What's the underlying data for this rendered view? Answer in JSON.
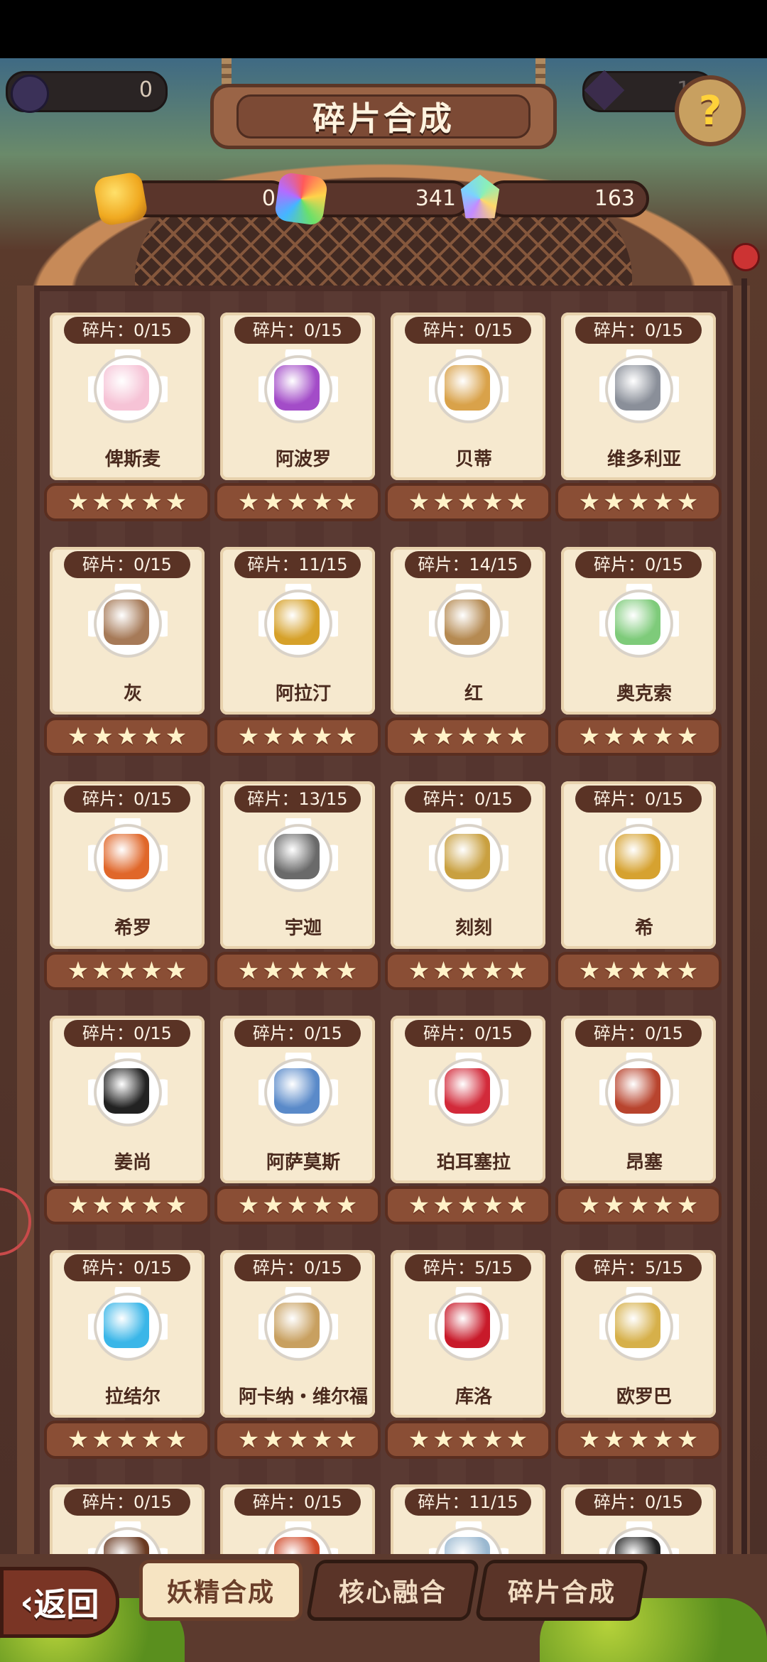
{
  "top": {
    "left_currency_value": "0",
    "right_currency_value": "1"
  },
  "header": {
    "title": "碎片合成",
    "help_label": "?"
  },
  "currencies": [
    {
      "icon": "gold-puzzle-piece-icon",
      "value": "0"
    },
    {
      "icon": "rainbow-puzzle-piece-icon",
      "value": "341"
    },
    {
      "icon": "crystal-icon",
      "value": "163"
    }
  ],
  "cards": [
    {
      "fragments": "碎片：0/15",
      "name": "俾斯麦",
      "item": "marshmallow",
      "color": "#f6c3d6"
    },
    {
      "fragments": "碎片：0/15",
      "name": "阿波罗",
      "item": "purple-orb",
      "color": "#a34cc8"
    },
    {
      "fragments": "碎片：0/15",
      "name": "贝蒂",
      "item": "scissors",
      "color": "#d9a24a"
    },
    {
      "fragments": "碎片：0/15",
      "name": "维多利亚",
      "item": "dish",
      "color": "#8a8f99"
    },
    {
      "fragments": "碎片：0/15",
      "name": "灰",
      "item": "brush",
      "color": "#a67a58"
    },
    {
      "fragments": "碎片：11/15",
      "name": "阿拉汀",
      "item": "lamp",
      "color": "#d6a12a"
    },
    {
      "fragments": "碎片：14/15",
      "name": "红",
      "item": "basket",
      "color": "#b58a52"
    },
    {
      "fragments": "碎片：0/15",
      "name": "奥克索",
      "item": "pinwheel",
      "color": "#7ecb7a"
    },
    {
      "fragments": "碎片：0/15",
      "name": "希罗",
      "item": "lantern",
      "color": "#e0672a"
    },
    {
      "fragments": "碎片：13/15",
      "name": "宇迦",
      "item": "drum",
      "color": "#6a6a6a"
    },
    {
      "fragments": "碎片：0/15",
      "name": "刻刻",
      "item": "pocket-watch",
      "color": "#c9a040"
    },
    {
      "fragments": "碎片：0/15",
      "name": "希",
      "item": "key",
      "color": "#d6a230"
    },
    {
      "fragments": "碎片：0/15",
      "name": "姜尚",
      "item": "yin-yang",
      "color": "#222222"
    },
    {
      "fragments": "碎片：0/15",
      "name": "阿萨莫斯",
      "item": "eye-orb",
      "color": "#5a8ac9"
    },
    {
      "fragments": "碎片：0/15",
      "name": "珀耳塞拉",
      "item": "dice",
      "color": "#d22a3a"
    },
    {
      "fragments": "碎片：0/15",
      "name": "昂塞",
      "item": "book",
      "color": "#b8442e"
    },
    {
      "fragments": "碎片：0/15",
      "name": "拉结尔",
      "item": "mirror",
      "color": "#3ab6e8"
    },
    {
      "fragments": "碎片：0/15",
      "name": "阿卡纳・维尔福",
      "item": "card",
      "color": "#c8a060"
    },
    {
      "fragments": "碎片：5/15",
      "name": "库洛",
      "item": "apple",
      "color": "#c81a2a"
    },
    {
      "fragments": "碎片：5/15",
      "name": "欧罗巴",
      "item": "harp",
      "color": "#d6b04a"
    },
    {
      "fragments": "碎片：0/15",
      "name": "",
      "item": "violin",
      "color": "#6a3a22"
    },
    {
      "fragments": "碎片：0/15",
      "name": "",
      "item": "crown",
      "color": "#d04a2a"
    },
    {
      "fragments": "碎片：11/15",
      "name": "",
      "item": "bracelet",
      "color": "#9ab8d0"
    },
    {
      "fragments": "碎片：0/15",
      "name": "",
      "item": "mask",
      "color": "#222222"
    }
  ],
  "stars_per_card": 5,
  "star_glyph": "★",
  "bottom_nav": {
    "back_label": "返回",
    "back_arrow": "‹",
    "tabs": [
      {
        "label": "妖精合成",
        "active": true
      },
      {
        "label": "核心融合",
        "active": false
      },
      {
        "label": "碎片合成",
        "active": false
      }
    ]
  }
}
